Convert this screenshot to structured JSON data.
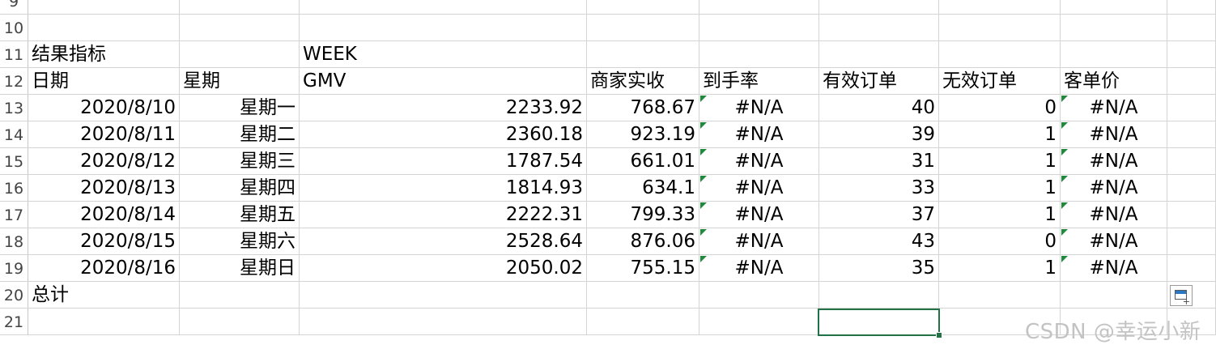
{
  "sheet": {
    "row_numbers": [
      "9",
      "10",
      "11",
      "12",
      "13",
      "14",
      "15",
      "16",
      "17",
      "18",
      "19",
      "20",
      "21"
    ],
    "row11": {
      "label": "结果指标",
      "week": "WEEK"
    },
    "headers": {
      "date": "日期",
      "weekday": "星期",
      "gmv": "GMV",
      "merchant_income": "商家实收",
      "arrival_rate": "到手率",
      "valid_orders": "有效订单",
      "invalid_orders": "无效订单",
      "avg_order_value": "客单价"
    },
    "rows": [
      {
        "date": "2020/8/10",
        "weekday": "星期一",
        "gmv": "2233.92",
        "merchant_income": "768.67",
        "arrival_rate": "#N/A",
        "valid_orders": "40",
        "invalid_orders": "0",
        "avg_order_value": "#N/A"
      },
      {
        "date": "2020/8/11",
        "weekday": "星期二",
        "gmv": "2360.18",
        "merchant_income": "923.19",
        "arrival_rate": "#N/A",
        "valid_orders": "39",
        "invalid_orders": "1",
        "avg_order_value": "#N/A"
      },
      {
        "date": "2020/8/12",
        "weekday": "星期三",
        "gmv": "1787.54",
        "merchant_income": "661.01",
        "arrival_rate": "#N/A",
        "valid_orders": "31",
        "invalid_orders": "1",
        "avg_order_value": "#N/A"
      },
      {
        "date": "2020/8/13",
        "weekday": "星期四",
        "gmv": "1814.93",
        "merchant_income": "634.1",
        "arrival_rate": "#N/A",
        "valid_orders": "33",
        "invalid_orders": "1",
        "avg_order_value": "#N/A"
      },
      {
        "date": "2020/8/14",
        "weekday": "星期五",
        "gmv": "2222.31",
        "merchant_income": "799.33",
        "arrival_rate": "#N/A",
        "valid_orders": "37",
        "invalid_orders": "1",
        "avg_order_value": "#N/A"
      },
      {
        "date": "2020/8/15",
        "weekday": "星期六",
        "gmv": "2528.64",
        "merchant_income": "876.06",
        "arrival_rate": "#N/A",
        "valid_orders": "43",
        "invalid_orders": "0",
        "avg_order_value": "#N/A"
      },
      {
        "date": "2020/8/16",
        "weekday": "星期日",
        "gmv": "2050.02",
        "merchant_income": "755.15",
        "arrival_rate": "#N/A",
        "valid_orders": "35",
        "invalid_orders": "1",
        "avg_order_value": "#N/A"
      }
    ],
    "total_label": "总计"
  },
  "watermark": "CSDN @幸运小新",
  "colors": {
    "gridline": "#d4d4d4",
    "selection_border": "#217346",
    "error_indicator": "#1f8a3c",
    "row_header_text": "#444444"
  },
  "icons": {
    "error_indicator": "green-triangle-icon",
    "quick_analysis": "quick-analysis-icon"
  }
}
